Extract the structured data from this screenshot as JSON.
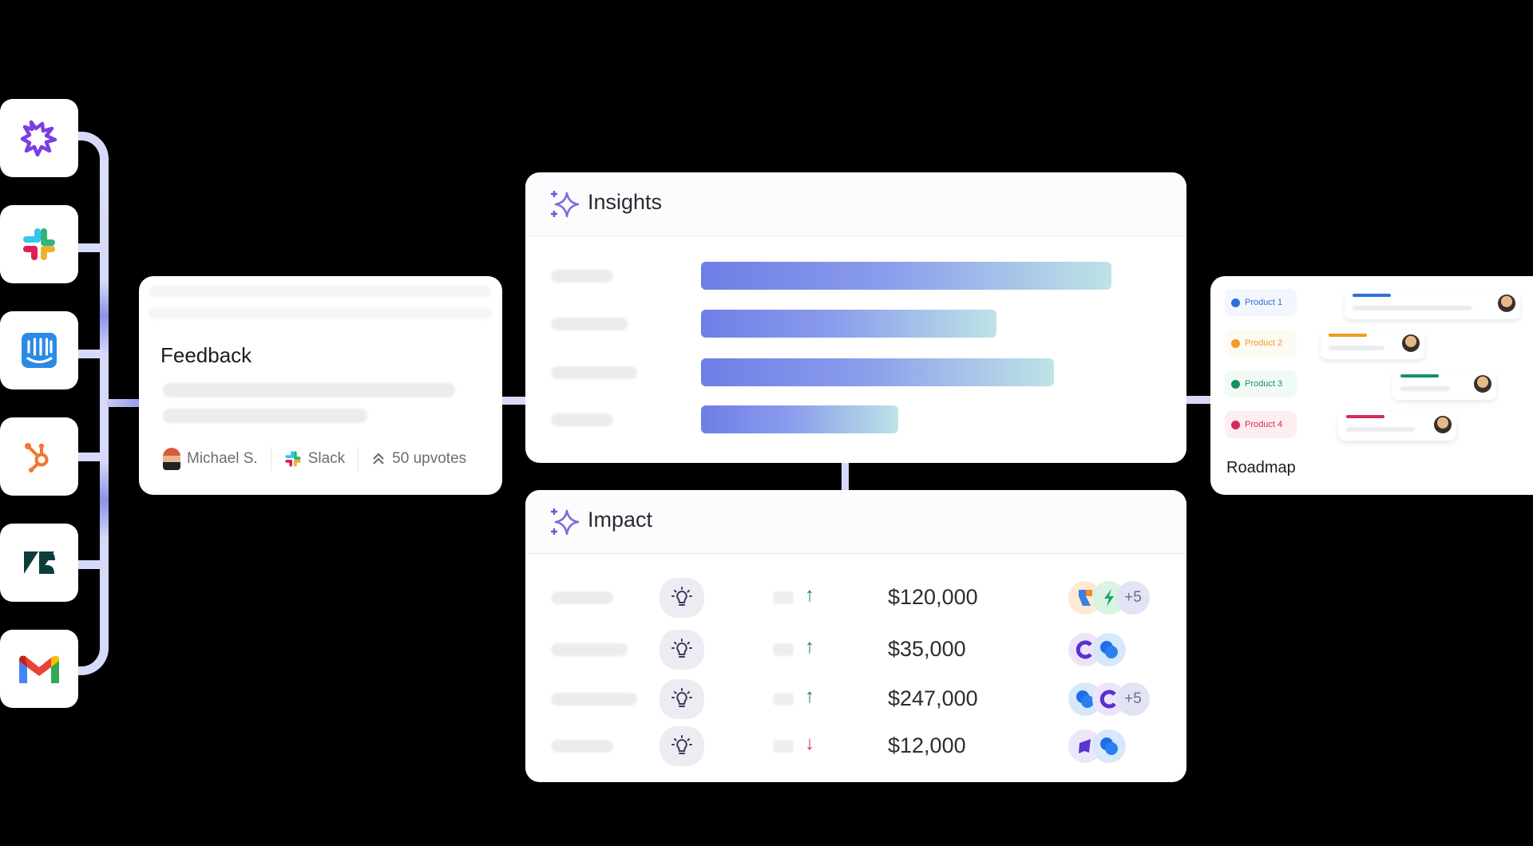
{
  "sources": [
    {
      "name": "productboard",
      "icon": "spark-burst-icon"
    },
    {
      "name": "Slack",
      "icon": "slack-icon"
    },
    {
      "name": "Intercom",
      "icon": "intercom-icon"
    },
    {
      "name": "HubSpot",
      "icon": "hubspot-icon"
    },
    {
      "name": "Zendesk",
      "icon": "zendesk-icon"
    },
    {
      "name": "Gmail",
      "icon": "gmail-icon"
    }
  ],
  "feedback": {
    "title": "Feedback",
    "author": "Michael S.",
    "source": "Slack",
    "upvotes": "50 upvotes"
  },
  "insights": {
    "title": "Insights",
    "bars": [
      {
        "value": 0.79
      },
      {
        "value": 0.57
      },
      {
        "value": 0.68
      },
      {
        "value": 0.38
      }
    ],
    "bar_gradient": [
      "#6f7ee6",
      "#bfe3e6"
    ]
  },
  "impact": {
    "title": "Impact",
    "rows": [
      {
        "trend": "up",
        "amount": "$120,000",
        "avatars": [
          "orange-blue-logo",
          "green-bolt-logo"
        ],
        "more": "+5"
      },
      {
        "trend": "up",
        "amount": "$35,000",
        "avatars": [
          "purple-c-logo",
          "blue-bubble-logo"
        ],
        "more": ""
      },
      {
        "trend": "up",
        "amount": "$247,000",
        "avatars": [
          "blue-bubble-logo",
          "purple-c-logo"
        ],
        "more": "+5"
      },
      {
        "trend": "down",
        "amount": "$12,000",
        "avatars": [
          "purple-flag-logo",
          "blue-bubble-logo"
        ],
        "more": ""
      }
    ],
    "colors": {
      "up": "#12855a",
      "down": "#d4333f"
    }
  },
  "roadmap": {
    "title": "Roadmap",
    "products": [
      {
        "label": "Product 1",
        "color": "#2f6fdc",
        "bg": "#f3f6fc"
      },
      {
        "label": "Product 2",
        "color": "#f29a24",
        "bg": "#fdfaf3"
      },
      {
        "label": "Product 3",
        "color": "#16915e",
        "bg": "#f2faf5"
      },
      {
        "label": "Product 4",
        "color": "#d42a5a",
        "bg": "#fdeef0"
      }
    ]
  }
}
